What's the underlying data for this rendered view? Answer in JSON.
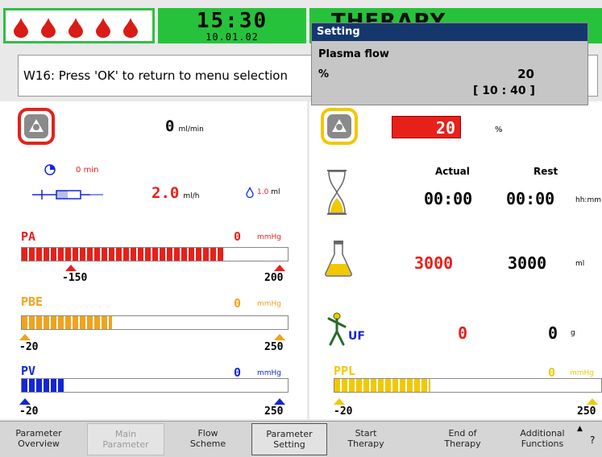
{
  "header": {
    "time": "15:30",
    "date": "10.01.02",
    "title": "THERAPY"
  },
  "message": "W16: Press 'OK' to return to menu selection",
  "dialog": {
    "title": "Setting",
    "parameter": "Plasma flow",
    "unit": "%",
    "value": "20",
    "range": "[ 10 : 40 ]"
  },
  "left": {
    "pump_flow": {
      "value": "0",
      "unit": "ml/min"
    },
    "heparin": {
      "time_value": "0",
      "time_unit": "min",
      "rate_value": "2.0",
      "rate_unit": "ml/h",
      "volume": "1.0",
      "volume_unit": "ml"
    },
    "pa": {
      "label": "PA",
      "value": "0",
      "unit": "mmHg",
      "min": "-150",
      "max": "200",
      "fill": 0.76,
      "color": "#e8201a"
    },
    "pbe": {
      "label": "PBE",
      "value": "0",
      "unit": "mmHg",
      "min": "-20",
      "max": "250",
      "fill": 0.34,
      "color": "#f0a31d"
    },
    "pv": {
      "label": "PV",
      "value": "0",
      "unit": "mmHg",
      "min": "-20",
      "max": "250",
      "fill": 0.16,
      "color": "#1226d8"
    }
  },
  "right": {
    "plasma_pump": {
      "value": "20",
      "unit": "%"
    },
    "columns": {
      "actual": "Actual",
      "rest": "Rest"
    },
    "time_row": {
      "actual": "00:00",
      "rest": "00:00",
      "unit": "hh:mm"
    },
    "volume_row": {
      "actual": "3000",
      "rest": "3000",
      "unit": "ml"
    },
    "uf_row": {
      "icon_label": "UF",
      "actual": "0",
      "rest": "0",
      "unit": "g"
    },
    "ppl": {
      "label": "PPL",
      "value": "0",
      "unit": "mmHg",
      "min": "-20",
      "max": "250",
      "fill": 0.36,
      "color": "#f2c800"
    }
  },
  "softkeys": [
    {
      "line1": "Parameter",
      "line2": "Overview"
    },
    {
      "line1": "Main",
      "line2": "Parameter"
    },
    {
      "line1": "Flow",
      "line2": "Scheme"
    },
    {
      "line1": "Parameter",
      "line2": "Setting"
    },
    {
      "line1": "Start",
      "line2": "Therapy"
    },
    {
      "line1": "End of",
      "line2": "Therapy"
    },
    {
      "line1": "Additional",
      "line2": "Functions"
    }
  ],
  "help_symbol": "?",
  "colors": {
    "header_green": "#27c23c",
    "dialog_blue": "#16376e",
    "alarm_red": "#e8201a"
  }
}
